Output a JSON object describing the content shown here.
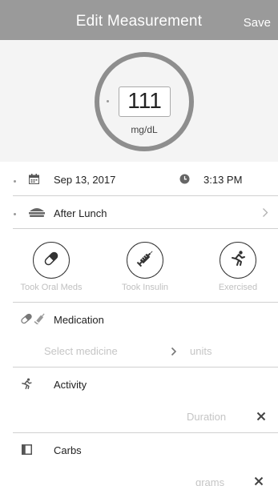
{
  "header": {
    "title": "Edit Measurement",
    "save_label": "Save"
  },
  "reading": {
    "value": "111",
    "unit": "mg/dL"
  },
  "datetime": {
    "date": "Sep 13, 2017",
    "time": "3:13 PM"
  },
  "meal": {
    "label": "After Lunch"
  },
  "quick_actions": [
    {
      "label": "Took Oral Meds",
      "icon": "pill-icon"
    },
    {
      "label": "Took Insulin",
      "icon": "syringe-icon"
    },
    {
      "label": "Exercised",
      "icon": "runner-icon"
    }
  ],
  "medication": {
    "title": "Medication",
    "select_placeholder": "Select medicine",
    "units_placeholder": "units"
  },
  "activity": {
    "title": "Activity",
    "duration_placeholder": "Duration"
  },
  "carbs": {
    "title": "Carbs",
    "grams_placeholder": "grams"
  },
  "icons": {
    "calendar": "calendar-icon",
    "clock": "clock-icon",
    "meal": "meal-icon",
    "chevron": "chevron-right-icon",
    "clear": "close-icon",
    "medication": "pill-syringe-icon",
    "activity": "runner-icon",
    "carbs": "carbs-box-icon"
  },
  "colors": {
    "header_bg": "#9a9a9a",
    "ring": "#8e8e8e",
    "placeholder": "#c5c5c5",
    "hero_bg": "#f4f4f4"
  }
}
